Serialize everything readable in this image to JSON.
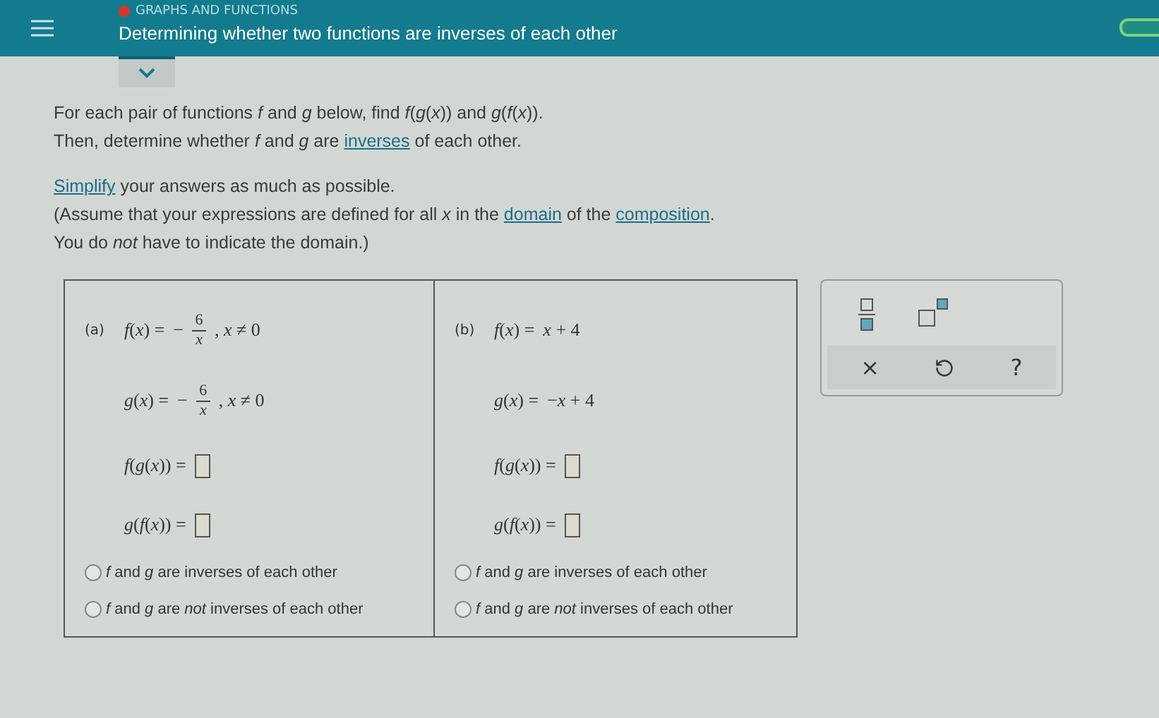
{
  "header": {
    "category": "GRAPHS AND FUNCTIONS",
    "title": "Determining whether two functions are inverses of each other"
  },
  "instructions": [
    [
      {
        "text": "For each pair of functions *f* and *g* below, find *f*(*g*(*x*)) and *g*(*f*(*x*)).",
        "link": false
      }
    ],
    [
      {
        "text": "Then, determine whether *f* and *g* are ",
        "link": false
      },
      {
        "text": "inverses",
        "link": true
      },
      {
        "text": " of each other.",
        "link": false
      }
    ],
    [
      {
        "text": "Simplify",
        "link": true
      },
      {
        "text": " your answers as much as possible.",
        "link": false
      }
    ],
    [
      {
        "text": "(Assume that your expressions are defined for all *x* in the ",
        "link": false
      },
      {
        "text": "domain",
        "link": true
      },
      {
        "text": " of the ",
        "link": false
      },
      {
        "text": "composition",
        "link": true
      },
      {
        "text": ".",
        "link": false
      }
    ],
    [
      {
        "text": "You do *not* have to indicate the domain.)",
        "link": false
      }
    ]
  ],
  "problems": [
    {
      "label": "(a)",
      "given": [
        {
          "lhs": "*f*(*x*) =",
          "kind": "fraction",
          "sign": "−",
          "num": "6",
          "den": "*x*",
          "cond": ", *x* ≠ 0"
        },
        {
          "lhs": "*g*(*x*) =",
          "kind": "fraction",
          "sign": "−",
          "num": "6",
          "den": "*x*",
          "cond": ", *x* ≠ 0"
        }
      ],
      "answers": [
        "*f*(*g*(*x*)) =",
        "*g*(*f*(*x*)) ="
      ],
      "options": [
        {
          "text": "*f* and *g* are inverses of each other",
          "selected": false
        },
        {
          "text": "*f* and *g* are *not* inverses of each other",
          "selected": false
        }
      ]
    },
    {
      "label": "(b)",
      "given": [
        {
          "lhs": "*f*(*x*) =",
          "kind": "plain",
          "rhs": "*x* + 4"
        },
        {
          "lhs": "*g*(*x*) =",
          "kind": "plain",
          "rhs": "−*x* + 4"
        }
      ],
      "answers": [
        "*f*(*g*(*x*)) =",
        "*g*(*f*(*x*)) ="
      ],
      "options": [
        {
          "text": "*f* and *g* are inverses of each other",
          "selected": false
        },
        {
          "text": "*f* and *g* are *not* inverses of each other",
          "selected": false
        }
      ]
    }
  ],
  "palette": [
    {
      "kind": "fraction"
    },
    {
      "kind": "superscript"
    }
  ],
  "actions": [
    {
      "kind": "text",
      "label": "×"
    },
    {
      "kind": "undo"
    },
    {
      "kind": "text",
      "label": "?"
    }
  ]
}
